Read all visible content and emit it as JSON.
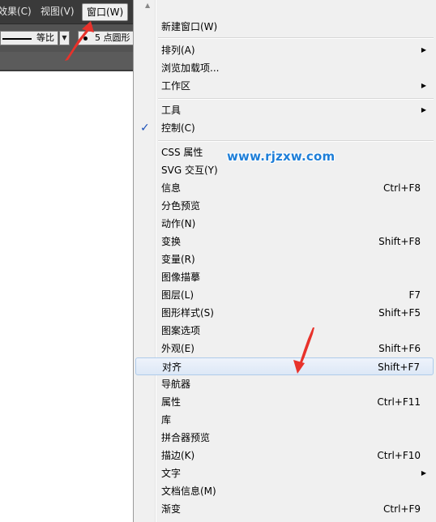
{
  "menubar": {
    "effect_label": "效果(C)",
    "view_label": "视图(V)",
    "window_label": "窗口(W)"
  },
  "controlbar": {
    "stroke_profile": "等比",
    "brush_label": "5 点圆形"
  },
  "menu": {
    "items": [
      {
        "label": "新建窗口(W)",
        "shortcut": "",
        "submenu": false,
        "checked": false
      },
      {
        "label": "排列(A)",
        "shortcut": "",
        "submenu": true,
        "checked": false
      },
      {
        "label": "浏览加载项...",
        "shortcut": "",
        "submenu": false,
        "checked": false
      },
      {
        "label": "工作区",
        "shortcut": "",
        "submenu": true,
        "checked": false
      },
      {
        "label": "工具",
        "shortcut": "",
        "submenu": true,
        "checked": false
      },
      {
        "label": "控制(C)",
        "shortcut": "",
        "submenu": false,
        "checked": true
      },
      {
        "label": "CSS 属性",
        "shortcut": "",
        "submenu": false,
        "checked": false
      },
      {
        "label": "SVG 交互(Y)",
        "shortcut": "",
        "submenu": false,
        "checked": false
      },
      {
        "label": "信息",
        "shortcut": "Ctrl+F8",
        "submenu": false,
        "checked": false
      },
      {
        "label": "分色预览",
        "shortcut": "",
        "submenu": false,
        "checked": false
      },
      {
        "label": "动作(N)",
        "shortcut": "",
        "submenu": false,
        "checked": false
      },
      {
        "label": "变换",
        "shortcut": "Shift+F8",
        "submenu": false,
        "checked": false
      },
      {
        "label": "变量(R)",
        "shortcut": "",
        "submenu": false,
        "checked": false
      },
      {
        "label": "图像描摹",
        "shortcut": "",
        "submenu": false,
        "checked": false
      },
      {
        "label": "图层(L)",
        "shortcut": "F7",
        "submenu": false,
        "checked": false
      },
      {
        "label": "图形样式(S)",
        "shortcut": "Shift+F5",
        "submenu": false,
        "checked": false
      },
      {
        "label": "图案选项",
        "shortcut": "",
        "submenu": false,
        "checked": false
      },
      {
        "label": "外观(E)",
        "shortcut": "Shift+F6",
        "submenu": false,
        "checked": false
      },
      {
        "label": "对齐",
        "shortcut": "Shift+F7",
        "submenu": false,
        "checked": false,
        "highlighted": true
      },
      {
        "label": "导航器",
        "shortcut": "",
        "submenu": false,
        "checked": false
      },
      {
        "label": "属性",
        "shortcut": "Ctrl+F11",
        "submenu": false,
        "checked": false
      },
      {
        "label": "库",
        "shortcut": "",
        "submenu": false,
        "checked": false
      },
      {
        "label": "拼合器预览",
        "shortcut": "",
        "submenu": false,
        "checked": false
      },
      {
        "label": "描边(K)",
        "shortcut": "Ctrl+F10",
        "submenu": false,
        "checked": false
      },
      {
        "label": "文字",
        "shortcut": "",
        "submenu": true,
        "checked": false
      },
      {
        "label": "文档信息(M)",
        "shortcut": "",
        "submenu": false,
        "checked": false
      },
      {
        "label": "渐变",
        "shortcut": "Ctrl+F9",
        "submenu": false,
        "checked": false
      }
    ]
  },
  "watermark": "www.rjzxw.com",
  "colors": {
    "menubar_bg": "#3a3a3a",
    "menu_bg": "#f0f0f0",
    "highlight_border": "#aecbea",
    "checkmark": "#1a4fb8",
    "watermark": "#1f7fd8",
    "annotation_arrow": "#e8322b"
  },
  "icons": {
    "submenu": "chevron-right-icon",
    "check": "checkmark-icon",
    "annotation": "red-arrow-icon"
  }
}
